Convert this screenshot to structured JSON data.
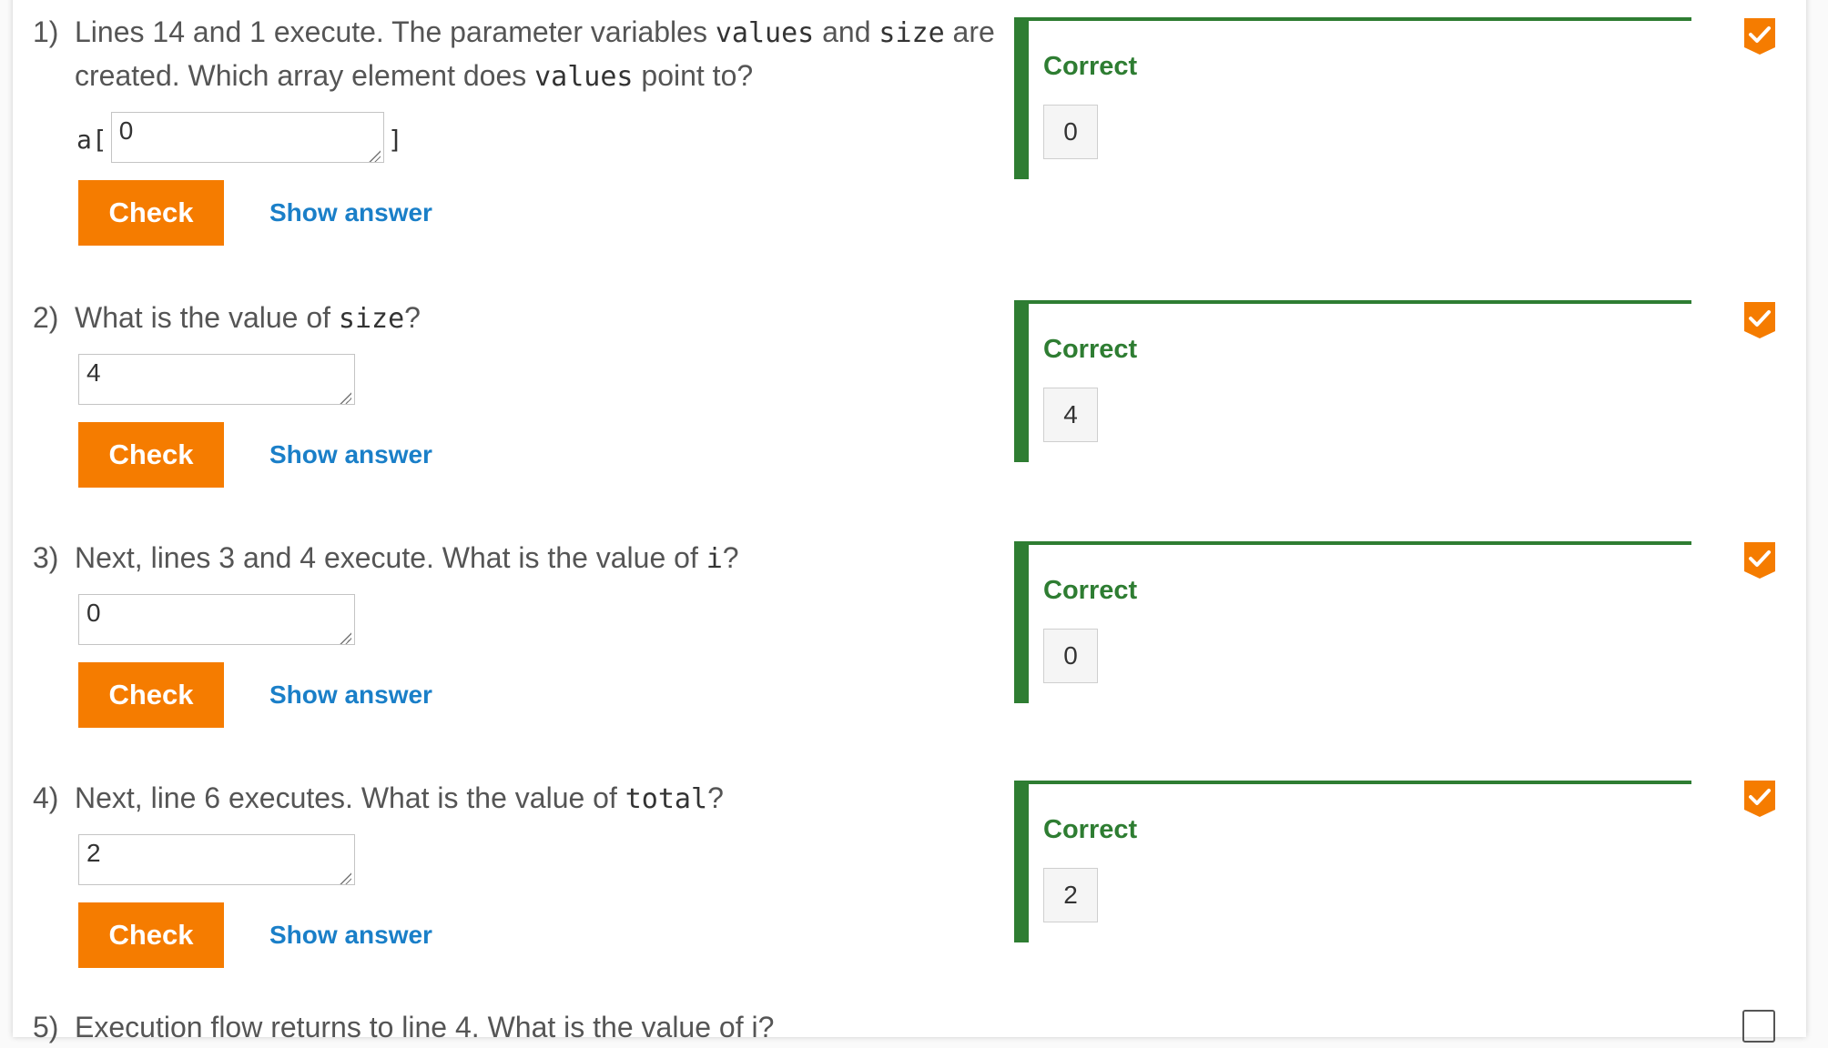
{
  "questions": [
    {
      "number": "1)",
      "parts": {
        "t1": "Lines 14 and 1 execute. The parameter variables ",
        "c1": "values",
        "t2": " and ",
        "c2": "size",
        "t3": " are created. Which array element does ",
        "c3": "values",
        "t4": " point to?"
      },
      "prefix": "a[",
      "suffix": "]",
      "answer": "0",
      "check_label": "Check",
      "show_answer_label": "Show answer",
      "feedback_label": "Correct",
      "feedback_value": "0",
      "status": "completed"
    },
    {
      "number": "2)",
      "parts": {
        "t1": "What is the value of ",
        "c1": "size",
        "t2": "?"
      },
      "answer": "4",
      "check_label": "Check",
      "show_answer_label": "Show answer",
      "feedback_label": "Correct",
      "feedback_value": "4",
      "status": "completed"
    },
    {
      "number": "3)",
      "parts": {
        "t1": "Next, lines 3 and 4 execute. What is the value of ",
        "c1": "i",
        "t2": "?"
      },
      "answer": "0",
      "check_label": "Check",
      "show_answer_label": "Show answer",
      "feedback_label": "Correct",
      "feedback_value": "0",
      "status": "completed"
    },
    {
      "number": "4)",
      "parts": {
        "t1": "Next, line 6 executes. What is the value of ",
        "c1": "total",
        "t2": "?"
      },
      "answer": "2",
      "check_label": "Check",
      "show_answer_label": "Show answer",
      "feedback_label": "Correct",
      "feedback_value": "2",
      "status": "completed"
    }
  ],
  "next_question_partial": {
    "number": "5)",
    "text": "Execution flow returns to line 4. What is the value of i?",
    "status": "incomplete"
  },
  "colors": {
    "check_button": "#f57c00",
    "show_answer": "#1a7fc8",
    "correct_green": "#2e7d32",
    "status_orange": "#f57c00"
  },
  "icons": {
    "status_complete": "checkmark-badge-icon",
    "status_incomplete": "empty-checkbox-icon",
    "resize": "resize-grip-icon"
  }
}
